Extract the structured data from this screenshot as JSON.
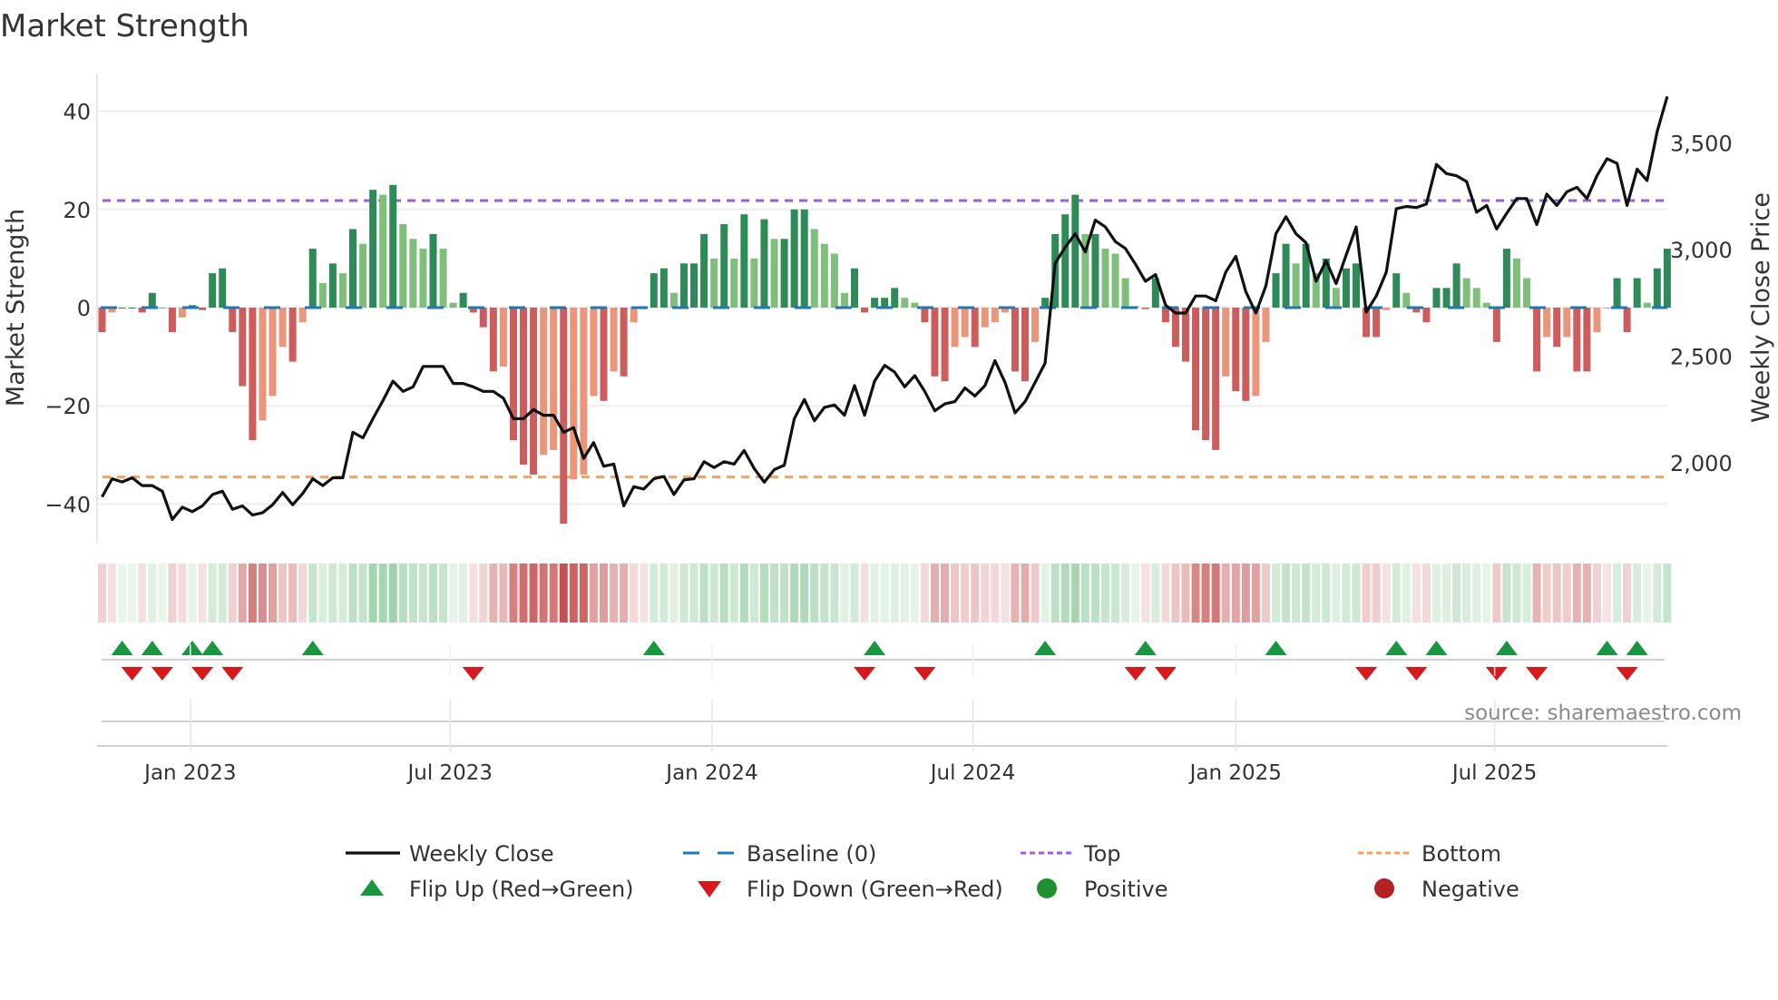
{
  "chart_data": {
    "type": "bar",
    "title": "Market Strength",
    "ylabel": "Market Strength",
    "y2label": "Weekly Close Price",
    "ylim": [
      -48,
      48
    ],
    "y2lim": [
      1650,
      3800
    ],
    "yticks": [
      40,
      20,
      0,
      -20,
      -40
    ],
    "ytick_labels": [
      "40",
      "20",
      "0",
      "−20",
      "−40"
    ],
    "y2ticks": [
      3500,
      3000,
      2500,
      2000
    ],
    "y2tick_labels": [
      "3,500",
      "3,000",
      "2,500",
      "2,000"
    ],
    "xtick_weeks": [
      8.8,
      34.7,
      60.8,
      86.8,
      113,
      138.8
    ],
    "xtick_labels": [
      "Jan 2023",
      "Jul 2023",
      "Jan 2024",
      "Jul 2024",
      "Jan 2025",
      "Jul 2025"
    ],
    "top_level": 21.8,
    "bottom_level": -34.5,
    "grid": true,
    "strength": [
      -5,
      -1,
      0,
      0,
      -1,
      3,
      0,
      -5,
      -2,
      0.5,
      -0.5,
      7,
      8,
      -5,
      -16,
      -27,
      -23,
      -18,
      -8,
      -11,
      -3,
      12,
      5,
      9,
      7,
      16,
      13,
      24,
      23,
      25,
      17,
      14,
      12,
      15,
      12,
      1,
      3,
      -1,
      -4,
      -13,
      -12,
      -27,
      -32,
      -34,
      -30,
      -29,
      -44,
      -35,
      -34,
      -18,
      -19,
      -13,
      -14,
      -3,
      -0.3,
      7,
      8,
      3,
      9,
      9,
      15,
      10,
      17,
      10,
      19,
      10,
      18,
      14,
      14,
      20,
      20,
      16,
      13,
      11,
      3,
      8,
      -1,
      2,
      2,
      4,
      2,
      1,
      -3,
      -14,
      -15,
      -8,
      -6,
      -8,
      -4,
      -3,
      -1,
      -13,
      -15,
      -7,
      2,
      15,
      19,
      23,
      15,
      15,
      12,
      11,
      6,
      0.3,
      -0.3,
      6,
      -3,
      -8,
      -11,
      -25,
      -27,
      -29,
      -14,
      -17,
      -19,
      -18,
      -7,
      7,
      13,
      9,
      13,
      7,
      10,
      4,
      8,
      9,
      -6,
      -6,
      -0.5,
      7,
      3,
      -1,
      -3,
      4,
      4,
      9,
      6,
      4,
      1,
      -7,
      12,
      10,
      6,
      -13,
      -6,
      -8,
      -6,
      -13,
      -13,
      -5,
      -0.2,
      6,
      -5,
      6,
      1,
      8,
      12
    ],
    "weekly_close": [
      1840,
      1925,
      1910,
      1930,
      1893,
      1893,
      1867,
      1734,
      1792,
      1771,
      1798,
      1851,
      1867,
      1782,
      1798,
      1755,
      1766,
      1803,
      1861,
      1803,
      1856,
      1925,
      1893,
      1930,
      1930,
      2143,
      2117,
      2207,
      2292,
      2383,
      2335,
      2356,
      2452,
      2452,
      2452,
      2372,
      2372,
      2356,
      2335,
      2335,
      2303,
      2207,
      2207,
      2250,
      2223,
      2223,
      2143,
      2165,
      2021,
      2095,
      1984,
      1994,
      1798,
      1888,
      1877,
      1925,
      1936,
      1851,
      1920,
      1925,
      2005,
      1978,
      2005,
      1994,
      2058,
      1973,
      1909,
      1968,
      1989,
      2207,
      2297,
      2197,
      2260,
      2271,
      2223,
      2362,
      2223,
      2383,
      2457,
      2425,
      2356,
      2409,
      2335,
      2244,
      2276,
      2287,
      2351,
      2313,
      2362,
      2479,
      2377,
      2234,
      2287,
      2377,
      2468,
      2936,
      3011,
      3074,
      2989,
      3138,
      3106,
      3037,
      3005,
      2931,
      2851,
      2883,
      2739,
      2702,
      2702,
      2782,
      2782,
      2760,
      2894,
      2968,
      2803,
      2702,
      2830,
      3074,
      3154,
      3074,
      3032,
      2851,
      2947,
      2840,
      2973,
      3106,
      2707,
      2782,
      2894,
      3191,
      3202,
      3197,
      3213,
      3399,
      3356,
      3346,
      3319,
      3175,
      3207,
      3096,
      3170,
      3239,
      3239,
      3117,
      3260,
      3207,
      3271,
      3292,
      3239,
      3346,
      3426,
      3404,
      3207,
      3377,
      3324,
      3553,
      3718
    ],
    "flip_up_weeks": [
      2,
      5,
      9,
      11,
      21,
      55,
      77,
      94,
      104,
      117,
      129,
      133,
      140,
      150,
      153
    ],
    "flip_down_weeks": [
      3,
      6,
      10,
      13,
      37,
      76,
      82,
      103,
      106,
      126,
      131,
      139,
      143,
      152
    ],
    "legend": {
      "placement": "bottom",
      "items": [
        {
          "label": "Weekly Close",
          "symbol": "line",
          "color": "#111111"
        },
        {
          "label": "Baseline (0)",
          "symbol": "dash",
          "color": "#1f77b4"
        },
        {
          "label": "Top",
          "symbol": "dot",
          "color": "#9b5de5"
        },
        {
          "label": "Bottom",
          "symbol": "dot",
          "color": "#f4a261"
        },
        {
          "label": "Flip Up (Red→Green)",
          "symbol": "triangle-up",
          "color": "#1a9641"
        },
        {
          "label": "Flip Down (Green→Red)",
          "symbol": "triangle-down",
          "color": "#d7191c"
        },
        {
          "label": "Positive",
          "symbol": "circle",
          "color": "#1f8f2f"
        },
        {
          "label": "Negative",
          "symbol": "circle",
          "color": "#b22222"
        }
      ]
    },
    "source": "source: sharemaestro.com"
  },
  "colors": {
    "pos_strong": "#2e8b57",
    "pos_weak": "#7fbf7b",
    "neg_strong": "#cd5c5c",
    "neg_weak": "#e9967a",
    "baseline": "#1f77b4",
    "top": "#9b5de5",
    "bottom": "#f4a261",
    "flip_up": "#1a9641",
    "flip_down": "#d7191c"
  }
}
